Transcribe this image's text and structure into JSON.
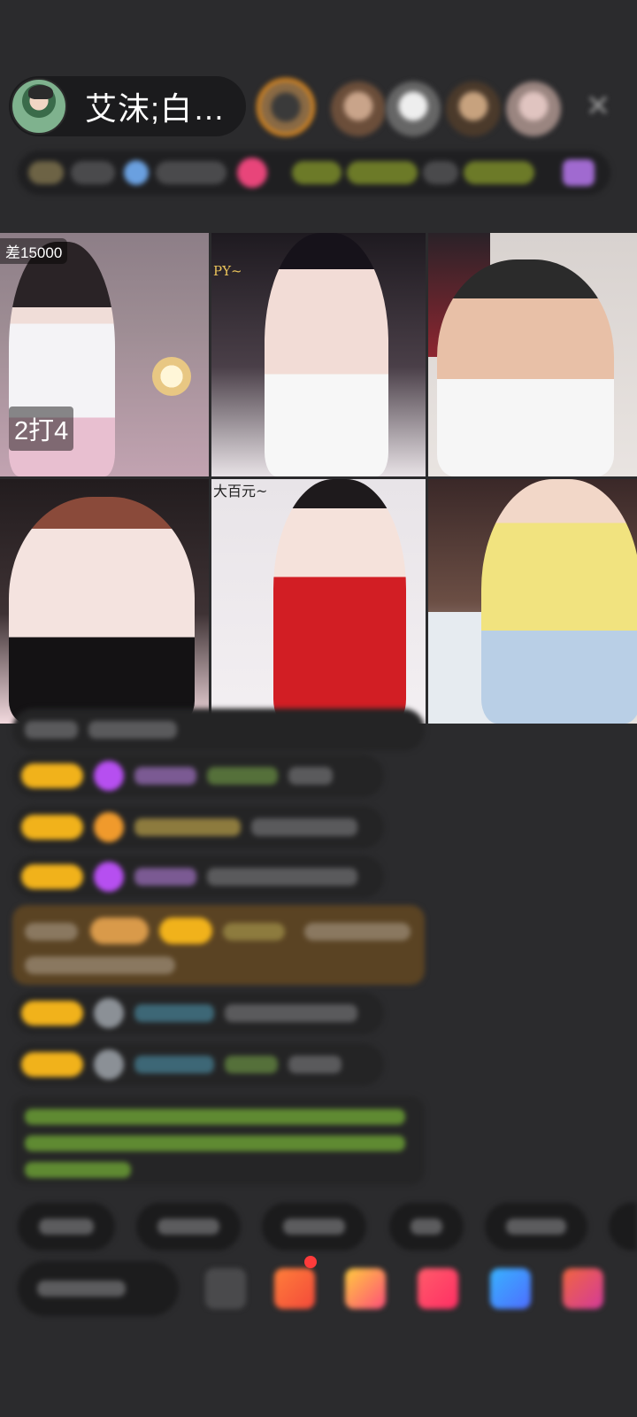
{
  "header": {
    "host_name": "艾沫;白…",
    "close_icon": "close-icon"
  },
  "viewers": [
    "viewer-1",
    "viewer-2",
    "viewer-3",
    "viewer-4",
    "viewer-5"
  ],
  "grid": {
    "tile1_top_label": "差15000",
    "tile1_score": "2打4",
    "tile2_top_label": "PY~",
    "tile5_top_label": "大百元~"
  },
  "colors": {
    "background": "#2b2b2d",
    "badge_gold": "#f1b21b",
    "accent_red": "#ff3b3b"
  }
}
